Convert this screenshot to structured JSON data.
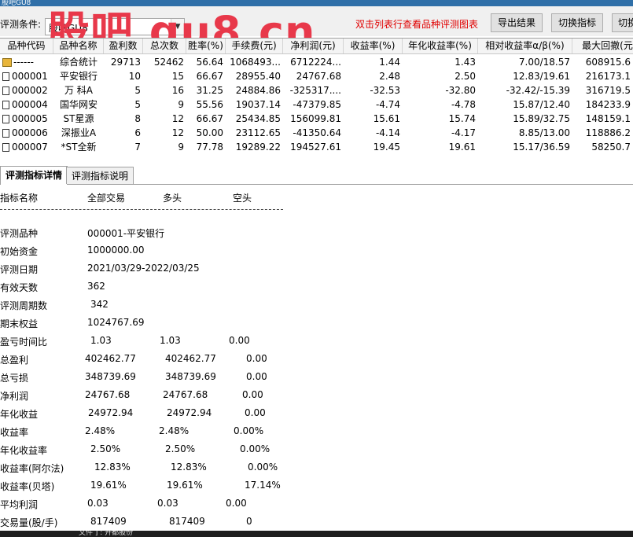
{
  "window": {
    "title": "股吧GU8"
  },
  "watermark": "股吧 gu8.cn",
  "toolbar": {
    "condition_label": "评测条件:",
    "condition_value": "股吧GU8",
    "hint": "双击列表行查看品种评测图表",
    "export_label": "导出结果",
    "switch_indicator_label": "切换指标",
    "switch_label": "切换"
  },
  "grid": {
    "columns": [
      "品种代码",
      "品种名称",
      "盈利数",
      "总次数",
      "胜率(%)",
      "手续费(元)",
      "净利润(元)",
      "收益率(%)",
      "年化收益率(%)",
      "相对收益率α/β(%)",
      "最大回撤(元"
    ],
    "rows": [
      {
        "code": "------",
        "name": "综合统计",
        "wins": "29713",
        "total": "52462",
        "winrate": "56.64",
        "fee": "1068493...",
        "profit": "6712224...",
        "ret": "1.44",
        "annual": "1.43",
        "rel": "7.00/18.57",
        "drawdown": "608915.6"
      },
      {
        "code": "000001",
        "name": "平安银行",
        "wins": "10",
        "total": "15",
        "winrate": "66.67",
        "fee": "28955.40",
        "profit": "24767.68",
        "ret": "2.48",
        "annual": "2.50",
        "rel": "12.83/19.61",
        "drawdown": "216173.1"
      },
      {
        "code": "000002",
        "name": "万 科A",
        "wins": "5",
        "total": "16",
        "winrate": "31.25",
        "fee": "24884.86",
        "profit": "-325317....",
        "ret": "-32.53",
        "annual": "-32.80",
        "rel": "-32.42/-15.39",
        "drawdown": "316719.5"
      },
      {
        "code": "000004",
        "name": "国华网安",
        "wins": "5",
        "total": "9",
        "winrate": "55.56",
        "fee": "19037.14",
        "profit": "-47379.85",
        "ret": "-4.74",
        "annual": "-4.78",
        "rel": "15.87/12.40",
        "drawdown": "184233.9"
      },
      {
        "code": "000005",
        "name": "ST星源",
        "wins": "8",
        "total": "12",
        "winrate": "66.67",
        "fee": "25434.85",
        "profit": "156099.81",
        "ret": "15.61",
        "annual": "15.74",
        "rel": "15.89/32.75",
        "drawdown": "148159.1"
      },
      {
        "code": "000006",
        "name": "深振业A",
        "wins": "6",
        "total": "12",
        "winrate": "50.00",
        "fee": "23112.65",
        "profit": "-41350.64",
        "ret": "-4.14",
        "annual": "-4.17",
        "rel": "8.85/13.00",
        "drawdown": "118886.2"
      },
      {
        "code": "000007",
        "name": "*ST全新",
        "wins": "7",
        "total": "9",
        "winrate": "77.78",
        "fee": "19289.22",
        "profit": "194527.61",
        "ret": "19.45",
        "annual": "19.61",
        "rel": "15.17/36.59",
        "drawdown": "58250.7"
      }
    ]
  },
  "tabs": [
    {
      "label": "评测指标详情",
      "active": true
    },
    {
      "label": "评测指标说明",
      "active": false
    }
  ],
  "detail": {
    "headers": {
      "name": "指标名称",
      "all": "全部交易",
      "long": "多头",
      "short": "空头"
    },
    "separator": "----------------------------------------------------------------------------",
    "rows": [
      {
        "label": "评测品种",
        "all": "000001-平安银行",
        "long": "",
        "short": ""
      },
      {
        "label": "初始资金",
        "all": "1000000.00",
        "long": "",
        "short": ""
      },
      {
        "label": "评测日期",
        "all": "2021/03/29-2022/03/25",
        "long": "",
        "short": ""
      },
      {
        "label": "有效天数",
        "all": "362",
        "long": "",
        "short": ""
      },
      {
        "label": "评测周期数",
        "all": "342",
        "long": "",
        "short": ""
      },
      {
        "label": "期末权益",
        "all": "1024767.69",
        "long": "",
        "short": ""
      },
      {
        "label": "盈亏时间比",
        "all": "1.03",
        "long": "1.03",
        "short": "0.00"
      },
      {
        "label": "总盈利",
        "all": "402462.77",
        "long": "402462.77",
        "short": "0.00"
      },
      {
        "label": "总亏损",
        "all": "348739.69",
        "long": "348739.69",
        "short": "0.00"
      },
      {
        "label": "净利润",
        "all": "24767.68",
        "long": "24767.68",
        "short": "0.00"
      },
      {
        "label": "年化收益",
        "all": "24972.94",
        "long": "24972.94",
        "short": "0.00"
      },
      {
        "label": "收益率",
        "all": "2.48%",
        "long": "2.48%",
        "short": "0.00%"
      },
      {
        "label": "年化收益率",
        "all": "2.50%",
        "long": "2.50%",
        "short": "0.00%"
      },
      {
        "label": "收益率(阿尔法)",
        "all": "12.83%",
        "long": "12.83%",
        "short": "0.00%"
      },
      {
        "label": "收益率(贝塔)",
        "all": "19.61%",
        "long": "19.61%",
        "short": "17.14%"
      },
      {
        "label": "平均利润",
        "all": "0.03",
        "long": "0.03",
        "short": "0.00"
      },
      {
        "label": "交易量(股/手)",
        "all": "817409",
        "long": "817409",
        "short": "0"
      }
    ]
  },
  "status": {
    "text": "文件 ] : 开都股份"
  }
}
